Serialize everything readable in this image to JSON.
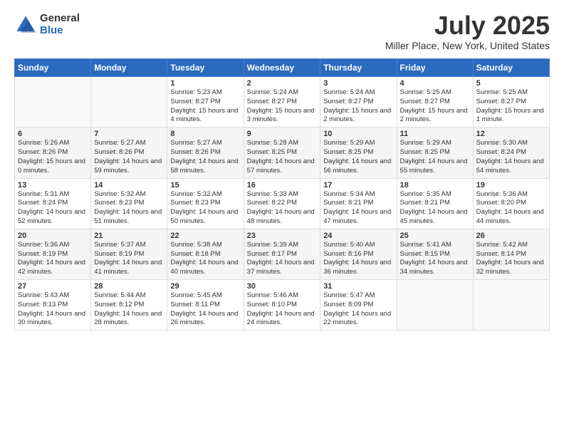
{
  "header": {
    "logo_general": "General",
    "logo_blue": "Blue",
    "title": "July 2025",
    "location": "Miller Place, New York, United States"
  },
  "weekdays": [
    "Sunday",
    "Monday",
    "Tuesday",
    "Wednesday",
    "Thursday",
    "Friday",
    "Saturday"
  ],
  "weeks": [
    [
      {
        "day": "",
        "info": ""
      },
      {
        "day": "",
        "info": ""
      },
      {
        "day": "1",
        "info": "Sunrise: 5:23 AM\nSunset: 8:27 PM\nDaylight: 15 hours\nand 4 minutes."
      },
      {
        "day": "2",
        "info": "Sunrise: 5:24 AM\nSunset: 8:27 PM\nDaylight: 15 hours\nand 3 minutes."
      },
      {
        "day": "3",
        "info": "Sunrise: 5:24 AM\nSunset: 8:27 PM\nDaylight: 15 hours\nand 2 minutes."
      },
      {
        "day": "4",
        "info": "Sunrise: 5:25 AM\nSunset: 8:27 PM\nDaylight: 15 hours\nand 2 minutes."
      },
      {
        "day": "5",
        "info": "Sunrise: 5:25 AM\nSunset: 8:27 PM\nDaylight: 15 hours\nand 1 minute."
      }
    ],
    [
      {
        "day": "6",
        "info": "Sunrise: 5:26 AM\nSunset: 8:26 PM\nDaylight: 15 hours\nand 0 minutes."
      },
      {
        "day": "7",
        "info": "Sunrise: 5:27 AM\nSunset: 8:26 PM\nDaylight: 14 hours\nand 59 minutes."
      },
      {
        "day": "8",
        "info": "Sunrise: 5:27 AM\nSunset: 8:26 PM\nDaylight: 14 hours\nand 58 minutes."
      },
      {
        "day": "9",
        "info": "Sunrise: 5:28 AM\nSunset: 8:25 PM\nDaylight: 14 hours\nand 57 minutes."
      },
      {
        "day": "10",
        "info": "Sunrise: 5:29 AM\nSunset: 8:25 PM\nDaylight: 14 hours\nand 56 minutes."
      },
      {
        "day": "11",
        "info": "Sunrise: 5:29 AM\nSunset: 8:25 PM\nDaylight: 14 hours\nand 55 minutes."
      },
      {
        "day": "12",
        "info": "Sunrise: 5:30 AM\nSunset: 8:24 PM\nDaylight: 14 hours\nand 54 minutes."
      }
    ],
    [
      {
        "day": "13",
        "info": "Sunrise: 5:31 AM\nSunset: 8:24 PM\nDaylight: 14 hours\nand 52 minutes."
      },
      {
        "day": "14",
        "info": "Sunrise: 5:32 AM\nSunset: 8:23 PM\nDaylight: 14 hours\nand 51 minutes."
      },
      {
        "day": "15",
        "info": "Sunrise: 5:32 AM\nSunset: 8:23 PM\nDaylight: 14 hours\nand 50 minutes."
      },
      {
        "day": "16",
        "info": "Sunrise: 5:33 AM\nSunset: 8:22 PM\nDaylight: 14 hours\nand 48 minutes."
      },
      {
        "day": "17",
        "info": "Sunrise: 5:34 AM\nSunset: 8:21 PM\nDaylight: 14 hours\nand 47 minutes."
      },
      {
        "day": "18",
        "info": "Sunrise: 5:35 AM\nSunset: 8:21 PM\nDaylight: 14 hours\nand 45 minutes."
      },
      {
        "day": "19",
        "info": "Sunrise: 5:36 AM\nSunset: 8:20 PM\nDaylight: 14 hours\nand 44 minutes."
      }
    ],
    [
      {
        "day": "20",
        "info": "Sunrise: 5:36 AM\nSunset: 8:19 PM\nDaylight: 14 hours\nand 42 minutes."
      },
      {
        "day": "21",
        "info": "Sunrise: 5:37 AM\nSunset: 8:19 PM\nDaylight: 14 hours\nand 41 minutes."
      },
      {
        "day": "22",
        "info": "Sunrise: 5:38 AM\nSunset: 8:18 PM\nDaylight: 14 hours\nand 40 minutes."
      },
      {
        "day": "23",
        "info": "Sunrise: 5:39 AM\nSunset: 8:17 PM\nDaylight: 14 hours\nand 37 minutes."
      },
      {
        "day": "24",
        "info": "Sunrise: 5:40 AM\nSunset: 8:16 PM\nDaylight: 14 hours\nand 36 minutes."
      },
      {
        "day": "25",
        "info": "Sunrise: 5:41 AM\nSunset: 8:15 PM\nDaylight: 14 hours\nand 34 minutes."
      },
      {
        "day": "26",
        "info": "Sunrise: 5:42 AM\nSunset: 8:14 PM\nDaylight: 14 hours\nand 32 minutes."
      }
    ],
    [
      {
        "day": "27",
        "info": "Sunrise: 5:43 AM\nSunset: 8:13 PM\nDaylight: 14 hours\nand 30 minutes."
      },
      {
        "day": "28",
        "info": "Sunrise: 5:44 AM\nSunset: 8:12 PM\nDaylight: 14 hours\nand 28 minutes."
      },
      {
        "day": "29",
        "info": "Sunrise: 5:45 AM\nSunset: 8:11 PM\nDaylight: 14 hours\nand 26 minutes."
      },
      {
        "day": "30",
        "info": "Sunrise: 5:46 AM\nSunset: 8:10 PM\nDaylight: 14 hours\nand 24 minutes."
      },
      {
        "day": "31",
        "info": "Sunrise: 5:47 AM\nSunset: 8:09 PM\nDaylight: 14 hours\nand 22 minutes."
      },
      {
        "day": "",
        "info": ""
      },
      {
        "day": "",
        "info": ""
      }
    ]
  ]
}
